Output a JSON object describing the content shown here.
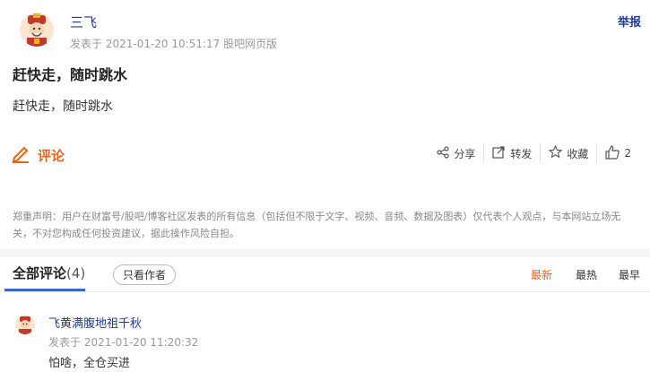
{
  "post": {
    "author": "三飞",
    "meta": "发表于 2021-01-20 10:51:17 股吧网页版",
    "report_label": "举报",
    "title": "赶快走，随时跳水",
    "body": "赶快走，随时跳水"
  },
  "actions": {
    "comment_label": "评论",
    "share_label": "分享",
    "forward_label": "转发",
    "favorite_label": "收藏",
    "like_count": "2"
  },
  "disclaimer": "郑重声明：用户在财富号/股吧/博客社区发表的所有信息（包括但不限于文字、视频、音频、数据及图表）仅代表个人观点，与本网站立场无关，不对您构成任何投资建议，据此操作风险自担。",
  "comments_tab": {
    "all_label": "全部评论",
    "count": "(4)",
    "only_author_label": "只看作者",
    "sort_newest": "最新",
    "sort_hottest": "最热",
    "sort_earliest": "最早"
  },
  "comments": [
    {
      "author": "飞黄满腹地祖千秋",
      "meta": "发表于 2021-01-20 11:20:32",
      "text": "怕啥，全仓买进"
    }
  ],
  "colors": {
    "accent": "#e8631a",
    "link": "#1f3a93",
    "tab_underline": "#3d66c8"
  }
}
